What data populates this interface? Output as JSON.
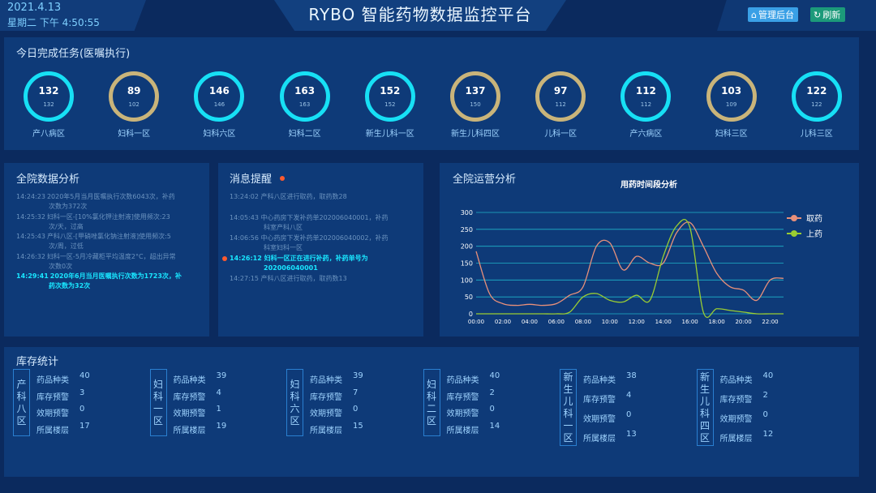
{
  "header": {
    "date": "2021.4.13",
    "time": "星期二 下午 4:50:55",
    "title": "RYBO 智能药物数据监控平台",
    "admin_button": "管理后台",
    "refresh_button": "刷新"
  },
  "tasks": {
    "title": "今日完成任务(医嘱执行)",
    "items": [
      {
        "value": "132",
        "total": "132",
        "label": "产八病区",
        "style": "cyan"
      },
      {
        "value": "89",
        "total": "102",
        "label": "妇科一区",
        "style": "gold"
      },
      {
        "value": "146",
        "total": "146",
        "label": "妇科六区",
        "style": "cyan"
      },
      {
        "value": "163",
        "total": "163",
        "label": "妇科二区",
        "style": "cyan"
      },
      {
        "value": "152",
        "total": "152",
        "label": "新生儿科一区",
        "style": "cyan"
      },
      {
        "value": "137",
        "total": "150",
        "label": "新生儿科四区",
        "style": "gold"
      },
      {
        "value": "97",
        "total": "112",
        "label": "儿科一区",
        "style": "gold"
      },
      {
        "value": "112",
        "total": "112",
        "label": "产六病区",
        "style": "cyan"
      },
      {
        "value": "103",
        "total": "109",
        "label": "妇科三区",
        "style": "gold"
      },
      {
        "value": "122",
        "total": "122",
        "label": "儿科三区",
        "style": "cyan"
      }
    ]
  },
  "analysis": {
    "title": "全院数据分析",
    "logs": [
      {
        "time": "14:24:23",
        "line1": "2020年5月当月医嘱执行次数6043次，补药",
        "line2": "次数为372次",
        "highlight": false
      },
      {
        "time": "14:25:32",
        "line1": "妇科一区-[10%氯化钾注射液]使用频次:23",
        "line2": "次/天，过高",
        "highlight": false
      },
      {
        "time": "14:25:43",
        "line1": "产科八区-[甲硝唑氯化钠注射液]使用频次:5",
        "line2": "次/周，过低",
        "highlight": false
      },
      {
        "time": "14:26:32",
        "line1": "妇科一区-5月冷藏柜平均温度2°C，超出异常",
        "line2": "次数0次",
        "highlight": false
      },
      {
        "time": "14:29:41",
        "line1": "2020年6月当月医嘱执行次数为1723次，补",
        "line2": "药次数为32次",
        "highlight": true
      }
    ]
  },
  "messages": {
    "title": "消息提醒",
    "items": [
      {
        "time": "13:24:02",
        "line1": "产科八区进行取药，取药数28",
        "line2": "",
        "highlight": false
      },
      {
        "time": "14:05:43",
        "line1": "中心药房下发补药单202006040001，补药",
        "line2": "科室产科八区",
        "highlight": false
      },
      {
        "time": "14:06:56",
        "line1": "中心药房下发补药单202006040002，补药",
        "line2": "科室妇科一区",
        "highlight": false
      },
      {
        "time": "14:26:12",
        "line1": "妇科一区正在进行补药，补药单号为",
        "line2": "202006040001",
        "highlight": true
      },
      {
        "time": "14:27:15",
        "line1": "产科八区进行取药，取药数13",
        "line2": "",
        "highlight": false
      }
    ]
  },
  "operations": {
    "title": "全院运营分析"
  },
  "chart_data": {
    "type": "line",
    "title": "用药时间段分析",
    "x": [
      "00:00",
      "01:00",
      "02:00",
      "03:00",
      "04:00",
      "05:00",
      "06:00",
      "07:00",
      "08:00",
      "09:00",
      "10:00",
      "11:00",
      "12:00",
      "13:00",
      "14:00",
      "15:00",
      "16:00",
      "17:00",
      "18:00",
      "19:00",
      "20:00",
      "21:00",
      "22:00",
      "23:00"
    ],
    "xticks": [
      "00:00",
      "02:00",
      "04:00",
      "06:00",
      "08:00",
      "10:00",
      "12:00",
      "14:00",
      "16:00",
      "18:00",
      "20:00",
      "22:00"
    ],
    "ylim": [
      0,
      300
    ],
    "yticks": [
      "0",
      "50",
      "100",
      "150",
      "200",
      "250",
      "300"
    ],
    "series": [
      {
        "name": "取药",
        "color": "#e8907a",
        "values": [
          185,
          60,
          30,
          25,
          28,
          25,
          30,
          55,
          80,
          200,
          210,
          130,
          170,
          150,
          150,
          240,
          270,
          200,
          120,
          80,
          70,
          40,
          100,
          105
        ]
      },
      {
        "name": "上药",
        "color": "#9acd32",
        "values": [
          0,
          0,
          0,
          0,
          0,
          0,
          0,
          5,
          50,
          60,
          40,
          35,
          55,
          40,
          170,
          260,
          255,
          5,
          15,
          10,
          5,
          0,
          0,
          0
        ]
      }
    ],
    "legend": "top-right",
    "grid": true
  },
  "inventory": {
    "title": "库存统计",
    "labels": {
      "types": "药品种类",
      "warn": "库存预警",
      "expire": "效期预警",
      "floor": "所属楼层"
    },
    "units": [
      {
        "name": "产科八区",
        "types": "40",
        "warn": "3",
        "expire": "0",
        "floor": "17"
      },
      {
        "name": "妇科一区",
        "types": "39",
        "warn": "4",
        "expire": "1",
        "floor": "19"
      },
      {
        "name": "妇科六区",
        "types": "39",
        "warn": "7",
        "expire": "0",
        "floor": "15"
      },
      {
        "name": "妇科二区",
        "types": "40",
        "warn": "2",
        "expire": "0",
        "floor": "14"
      },
      {
        "name": "新生儿科一区",
        "types": "38",
        "warn": "4",
        "expire": "0",
        "floor": "13"
      },
      {
        "name": "新生儿科四区",
        "types": "40",
        "warn": "2",
        "expire": "0",
        "floor": "12"
      }
    ]
  }
}
